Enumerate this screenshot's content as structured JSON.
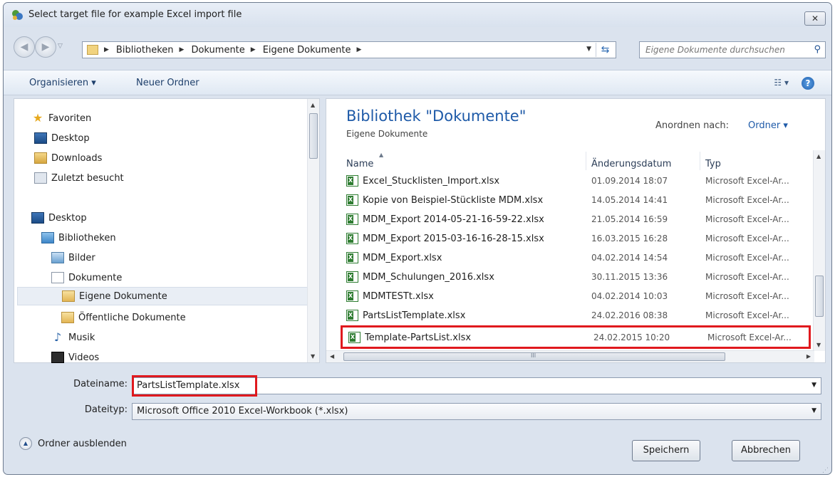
{
  "window": {
    "title": "Select target file for example Excel import file",
    "close_label": "✕"
  },
  "address": {
    "crumbs": [
      "Bibliotheken",
      "Dokumente",
      "Eigene Dokumente"
    ],
    "search_placeholder": "Eigene Dokumente durchsuchen"
  },
  "toolbar": {
    "organize_label": "Organisieren ▾",
    "new_folder_label": "Neuer Ordner"
  },
  "nav": {
    "items": [
      {
        "label": "Favoriten",
        "icon": "star-icon"
      },
      {
        "label": "Desktop",
        "icon": "desktop-icon"
      },
      {
        "label": "Downloads",
        "icon": "downloads-folder-icon"
      },
      {
        "label": "Zuletzt besucht",
        "icon": "recent-places-icon"
      },
      {
        "label": "Desktop",
        "icon": "desktop-icon"
      },
      {
        "label": "Bibliotheken",
        "icon": "libraries-icon"
      },
      {
        "label": "Bilder",
        "icon": "pictures-icon"
      },
      {
        "label": "Dokumente",
        "icon": "documents-icon"
      },
      {
        "label": "Eigene Dokumente",
        "icon": "folder-icon"
      },
      {
        "label": "Öffentliche Dokumente",
        "icon": "folder-icon"
      },
      {
        "label": "Musik",
        "icon": "music-icon"
      },
      {
        "label": "Videos",
        "icon": "videos-icon"
      }
    ]
  },
  "content": {
    "library_title": "Bibliothek \"Dokumente\"",
    "library_subtitle": "Eigene Dokumente",
    "arrange_label": "Anordnen nach:",
    "arrange_value": "Ordner ▾",
    "columns": {
      "name": "Name",
      "date": "Änderungsdatum",
      "type": "Typ"
    },
    "files": [
      {
        "name": "Excel_Stucklisten_Import.xlsx",
        "date": "01.09.2014 18:07",
        "type": "Microsoft Excel-Ar..."
      },
      {
        "name": "Kopie von Beispiel-Stückliste MDM.xlsx",
        "date": "14.05.2014 14:41",
        "type": "Microsoft Excel-Ar..."
      },
      {
        "name": "MDM_Export 2014-05-21-16-59-22.xlsx",
        "date": "21.05.2014 16:59",
        "type": "Microsoft Excel-Ar..."
      },
      {
        "name": "MDM_Export 2015-03-16-16-28-15.xlsx",
        "date": "16.03.2015 16:28",
        "type": "Microsoft Excel-Ar..."
      },
      {
        "name": "MDM_Export.xlsx",
        "date": "04.02.2014 14:54",
        "type": "Microsoft Excel-Ar..."
      },
      {
        "name": "MDM_Schulungen_2016.xlsx",
        "date": "30.11.2015 13:36",
        "type": "Microsoft Excel-Ar..."
      },
      {
        "name": "MDMTESTt.xlsx",
        "date": "04.02.2014 10:03",
        "type": "Microsoft Excel-Ar..."
      },
      {
        "name": "PartsListTemplate.xlsx",
        "date": "24.02.2016 08:38",
        "type": "Microsoft Excel-Ar..."
      },
      {
        "name": "Template-PartsList.xlsx",
        "date": "24.02.2015 10:20",
        "type": "Microsoft Excel-Ar..."
      }
    ],
    "hscroll_grip": "III"
  },
  "fields": {
    "filename_label": "Dateiname:",
    "filename_value": "PartsListTemplate.xlsx",
    "filetype_label": "Dateityp:",
    "filetype_value": "Microsoft Office 2010 Excel-Workbook (*.xlsx)"
  },
  "footer": {
    "hide_folders_label": "Ordner ausblenden",
    "save_label": "Speichern",
    "cancel_label": "Abbrechen"
  },
  "colors": {
    "highlight": "#e0191e",
    "accent": "#1e5aa8"
  }
}
